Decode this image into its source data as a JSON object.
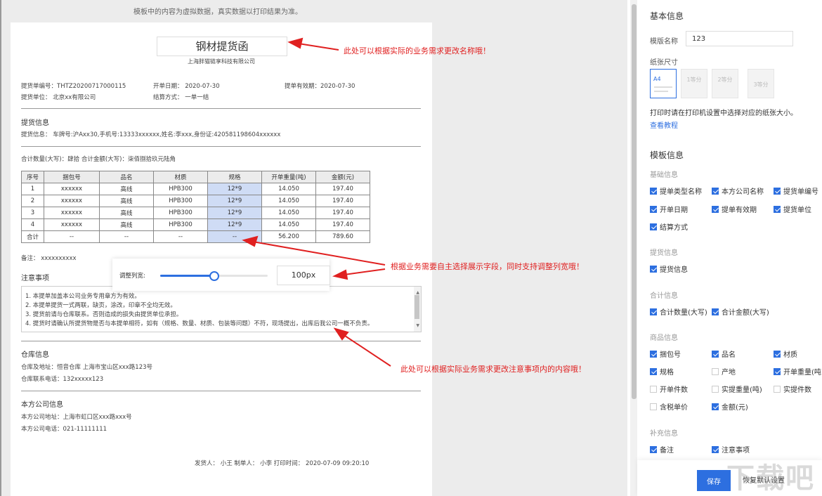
{
  "preview": {
    "notice": "模板中的内容为虚拟数据，真实数据以打印结果为准。",
    "doc_title": "钢材提货函",
    "company": "上海胖猫链享科技有限公司",
    "header_fields": {
      "bill_no": "提货单编号：THTZ20200717000115",
      "open_date": "开单日期：  2020-07-30",
      "valid_date": "提单有效期：2020-07-30",
      "unit": "提货单位：  北京xx有限公司",
      "settle": "结算方式：   一单一结"
    },
    "pickup": {
      "title": "提货信息",
      "info": "提货信息：   车牌号:沪Axx30,手机号:13333xxxxxx,姓名:李xxx,身份证:420581198604xxxxxx"
    },
    "totals": "合计数量(大写)：肆拾     合计金额(大写)：柒佰捌拾玖元陆角",
    "table": {
      "headers": [
        "序号",
        "捆包号",
        "品名",
        "材质",
        "规格",
        "开单重量(吨)",
        "金额(元)"
      ],
      "rows": [
        [
          "1",
          "xxxxxx",
          "高线",
          "HPB300",
          "12*9",
          "14.050",
          "197.40"
        ],
        [
          "2",
          "xxxxxx",
          "高线",
          "HPB300",
          "12*9",
          "14.050",
          "197.40"
        ],
        [
          "3",
          "xxxxxx",
          "高线",
          "HPB300",
          "12*9",
          "14.050",
          "197.40"
        ],
        [
          "4",
          "xxxxxx",
          "高线",
          "HPB300",
          "12*9",
          "14.050",
          "197.40"
        ],
        [
          "合计",
          "--",
          "--",
          "--",
          "--",
          "56.200",
          "789.60"
        ]
      ]
    },
    "remark": "备注：        xxxxxxxxxx",
    "notes_title": "注意事项",
    "notes": [
      "1. 本提单加盖本公司业务专用章方为有效。",
      "2. 本提单提货一式两联，缺页，涂改，印章不全均无效。",
      "3. 提货前请与仓库联系。否则造成的损失由提货单位承担。",
      "4. 提货时请确认所提货物是否与本提单相符，如有（规格、数量、材质、包装等问题）不符，现场提出，出库后我公司一概不负责。"
    ],
    "slider": {
      "label": "调整列宽:",
      "value": "100px",
      "percent": 50
    },
    "warehouse": {
      "title": "仓库信息",
      "address": "仓库及地址：恒音仓库 上海市宝山区xxx路123号",
      "phone": "仓库联系电话：132xxxxx123"
    },
    "our_company": {
      "title": "本方公司信息",
      "address": "本方公司地址：上海市虹口区xxx路xxx号",
      "phone": "本方公司电话：021-11111111"
    },
    "signature": "发货人：    小王    制单人：     小李    打印时间：   2020-07-09 09:20:10"
  },
  "annotations": {
    "a1": "此处可以根据实际的业务需求更改名称哦！",
    "a2": "根据业务需要自主选择展示字段，同时支持调整列宽哦！",
    "a3": "此处可以根据实际业务需求更改注意事项内的内容哦！"
  },
  "settings": {
    "basic_title": "基本信息",
    "name_label": "模版名称",
    "name_value": "123",
    "paper_label": "纸张尺寸",
    "paper_options": [
      "A4",
      "1等分",
      "2等分",
      "3等分"
    ],
    "paper_tip": "打印时请在打印机设置中选择对应的纸张大小。",
    "tutorial_link": "查看教程",
    "template_title": "模板信息",
    "groups": {
      "basic": {
        "title": "基础信息",
        "items": [
          {
            "label": "提单类型名称",
            "checked": true
          },
          {
            "label": "本方公司名称",
            "checked": true
          },
          {
            "label": "提货单编号",
            "checked": true
          },
          {
            "label": "开单日期",
            "checked": true
          },
          {
            "label": "提单有效期",
            "checked": true
          },
          {
            "label": "提货单位",
            "checked": true
          },
          {
            "label": "结算方式",
            "checked": true
          }
        ]
      },
      "pickup": {
        "title": "提货信息",
        "items": [
          {
            "label": "提货信息",
            "checked": true
          }
        ]
      },
      "total": {
        "title": "合计信息",
        "items": [
          {
            "label": "合计数量(大写)",
            "checked": true
          },
          {
            "label": "合计金额(大写)",
            "checked": true
          }
        ]
      },
      "goods": {
        "title": "商品信息",
        "items": [
          {
            "label": "捆包号",
            "checked": true
          },
          {
            "label": "品名",
            "checked": true
          },
          {
            "label": "材质",
            "checked": true
          },
          {
            "label": "规格",
            "checked": true
          },
          {
            "label": "产地",
            "checked": false
          },
          {
            "label": "开单重量(吨",
            "checked": true
          },
          {
            "label": "开单件数",
            "checked": false
          },
          {
            "label": "实提重量(吨)",
            "checked": false
          },
          {
            "label": "实提件数",
            "checked": false
          },
          {
            "label": "含税单价",
            "checked": false
          },
          {
            "label": "金额(元)",
            "checked": true
          }
        ]
      },
      "extra": {
        "title": "补充信息",
        "items": [
          {
            "label": "备注",
            "checked": true
          },
          {
            "label": "注意事项",
            "checked": true
          }
        ]
      }
    },
    "save": "保存",
    "reset": "恢复默认设置"
  },
  "watermark": "下载吧",
  "colors": {
    "accent": "#2d6fe0",
    "annotation": "#e02020"
  }
}
